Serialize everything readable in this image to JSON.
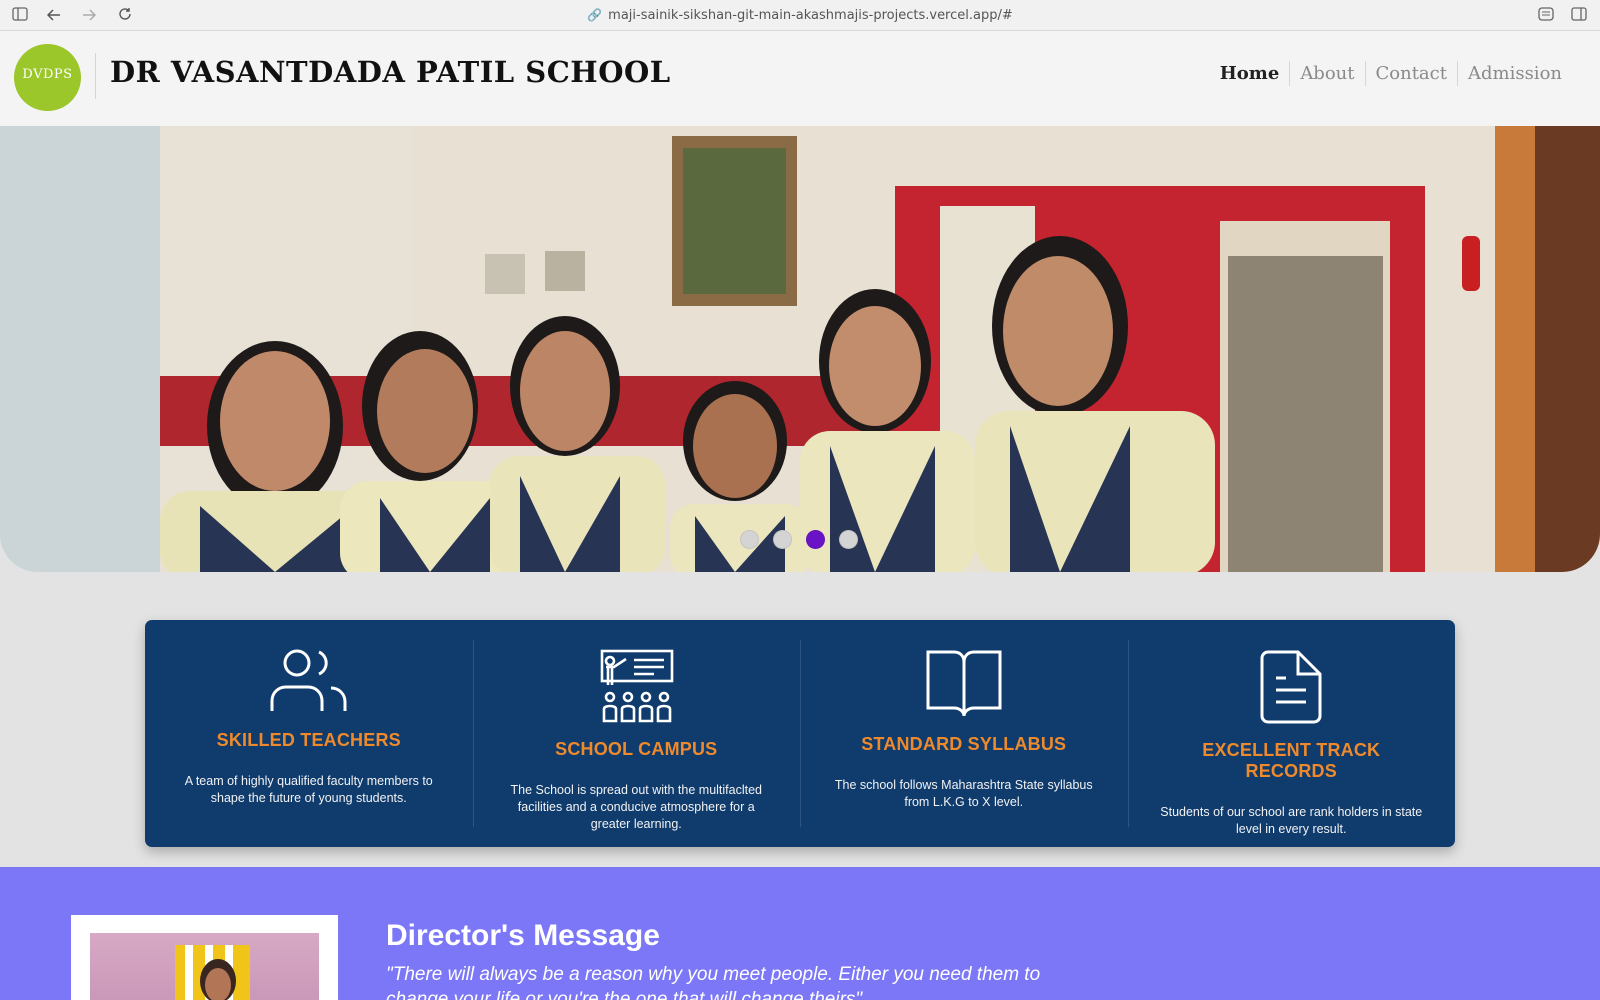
{
  "browser": {
    "url": "maji-sainik-sikshan-git-main-akashmajis-projects.vercel.app/#",
    "icons": [
      "sidebar-icon",
      "back-icon",
      "forward-icon",
      "reload-icon",
      "link-icon",
      "reader-icon",
      "split-view-icon"
    ]
  },
  "header": {
    "logo_text": "DVDPS",
    "title": "DR VASANTDADA PATIL SCHOOL",
    "nav": [
      "Home",
      "About",
      "Contact",
      "Admission"
    ],
    "active_nav": "Home"
  },
  "hero": {
    "slide_count": 4,
    "active_slide": 3,
    "colors": {
      "active_dot": "#6a12c6",
      "inactive_dot": "#d4d4d4"
    }
  },
  "features": [
    {
      "icon": "teachers-icon",
      "title": "SKILLED TEACHERS",
      "description": "A team of highly qualified faculty members to shape the future of young students."
    },
    {
      "icon": "classroom-icon",
      "title": "SCHOOL CAMPUS",
      "description": "The School is spread out with the multifaclted facilities and a conducive atmosphere for a greater learning."
    },
    {
      "icon": "book-icon",
      "title": "STANDARD SYLLABUS",
      "description": "The school follows Maharashtra State syllabus from L.K.G to X level."
    },
    {
      "icon": "document-icon",
      "title": "EXCELLENT TRACK RECORDS",
      "description": "Students of our school are rank holders in state level in every result."
    }
  ],
  "director": {
    "title": "Director's Message",
    "quote": "\"There will always be a reason why you meet people. Either you need them to change your life or you're the one that will change theirs\""
  },
  "colors": {
    "features_bg": "#0f3b6d",
    "feature_title": "#ee8a2c",
    "director_bg": "#7b77f7",
    "logo_bg": "#9bc72a"
  }
}
